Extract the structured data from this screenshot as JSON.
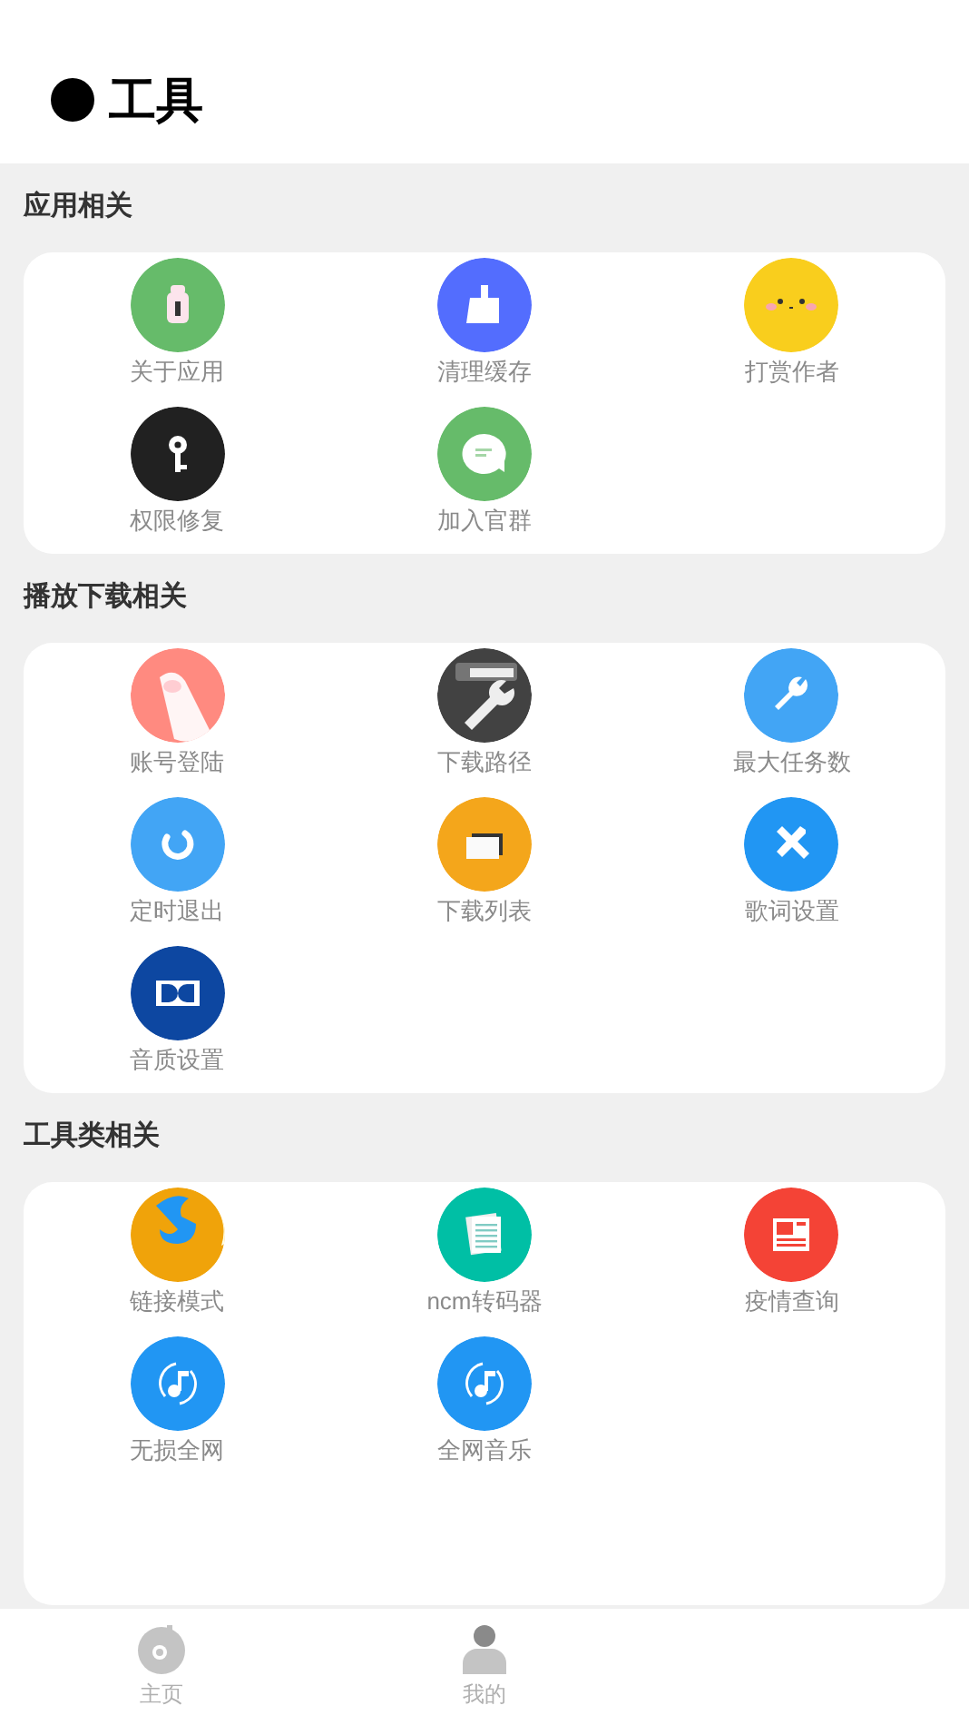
{
  "header": {
    "title": "工具"
  },
  "sections": [
    {
      "title": "应用相关",
      "tools": [
        {
          "label": "关于应用",
          "kind": "android",
          "color": "#66bb6a"
        },
        {
          "label": "清理缓存",
          "kind": "broom",
          "color": "#536dfe"
        },
        {
          "label": "打赏作者",
          "kind": "face",
          "color": "#f9ce1d"
        },
        {
          "label": "权限修复",
          "kind": "key",
          "color": "#212121"
        },
        {
          "label": "加入官群",
          "kind": "chat",
          "color": "#66bb6a"
        }
      ]
    },
    {
      "title": "播放下载相关",
      "tools": [
        {
          "label": "账号登陆",
          "kind": "paw",
          "color": "#ff8a80"
        },
        {
          "label": "下载路径",
          "kind": "folder",
          "color": "#424242"
        },
        {
          "label": "最大任务数",
          "kind": "wrench",
          "color": "#42a5f5"
        },
        {
          "label": "定时退出",
          "kind": "spinner",
          "color": "#42a5f5"
        },
        {
          "label": "下载列表",
          "kind": "window",
          "color": "#f4a61b"
        },
        {
          "label": "歌词设置",
          "kind": "tools",
          "color": "#2196f3"
        },
        {
          "label": "音质设置",
          "kind": "dolby",
          "color": "#0d47a1"
        }
      ]
    },
    {
      "title": "工具类相关",
      "tools": [
        {
          "label": "链接模式",
          "kind": "firefox",
          "color": "#f0a30a"
        },
        {
          "label": "ncm转码器",
          "kind": "document",
          "color": "#00bfa5"
        },
        {
          "label": "疫情查询",
          "kind": "news",
          "color": "#f44336"
        },
        {
          "label": "无损全网",
          "kind": "music",
          "color": "#2196f3"
        },
        {
          "label": "全网音乐",
          "kind": "music",
          "color": "#2196f3"
        }
      ]
    }
  ],
  "nav": [
    {
      "label": "主页",
      "kind": "disc",
      "selected": false
    },
    {
      "label": "我的",
      "kind": "person",
      "selected": false
    }
  ]
}
